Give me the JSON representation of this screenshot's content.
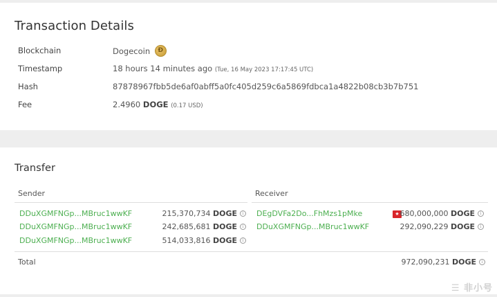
{
  "details": {
    "title": "Transaction Details",
    "blockchain_label": "Blockchain",
    "blockchain_value": "Dogecoin",
    "timestamp_label": "Timestamp",
    "timestamp_value": "18 hours 14 minutes ago",
    "timestamp_exact": "(Tue, 16 May 2023 17:17:45 UTC)",
    "hash_label": "Hash",
    "hash_value": "87878967fbb5de6af0abff5a0fc405d259c6a5869fdbca1a4822b08cb3b7b751",
    "fee_label": "Fee",
    "fee_amount": "2.4960",
    "fee_unit": "DOGE",
    "fee_usd": "(0.17 USD)",
    "coin_icon": "dogecoin-logo",
    "colors": {
      "link": "#4caf50",
      "background": "#eeeeee",
      "card": "#ffffff"
    }
  },
  "transfer": {
    "title": "Transfer",
    "sender_header": "Sender",
    "receiver_header": "Receiver",
    "senders": [
      {
        "address": "DDuXGMFNGp...MBruc1wwKF",
        "amount": "215,370,734",
        "unit": "DOGE"
      },
      {
        "address": "DDuXGMFNGp...MBruc1wwKF",
        "amount": "242,685,681",
        "unit": "DOGE"
      },
      {
        "address": "DDuXGMFNGp...MBruc1wwKF",
        "amount": "514,033,816",
        "unit": "DOGE"
      }
    ],
    "receivers": [
      {
        "address": "DEgDVFa2Do...FhMzs1pMke",
        "amount": "680,000,000",
        "unit": "DOGE",
        "icon": "exchange-flag-icon"
      },
      {
        "address": "DDuXGMFNGp...MBruc1wwKF",
        "amount": "292,090,229",
        "unit": "DOGE"
      }
    ],
    "total_label": "Total",
    "total_amount": "972,090,231",
    "total_unit": "DOGE"
  },
  "watermark": "☰ 非小号"
}
